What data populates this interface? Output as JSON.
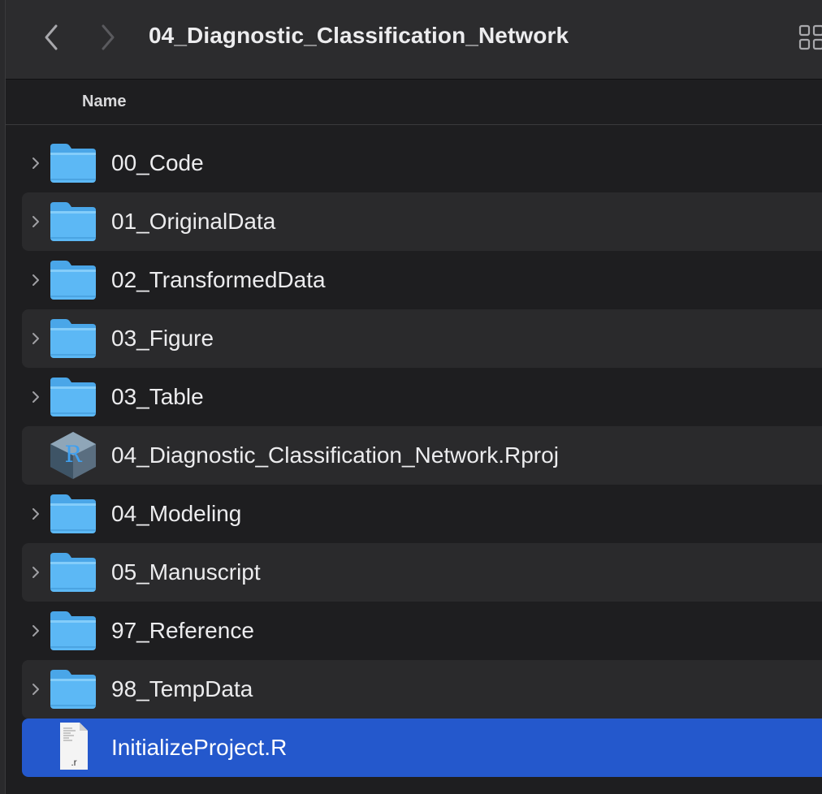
{
  "window": {
    "title": "04_Diagnostic_Classification_Network"
  },
  "toolbar": {
    "back_icon": "chevron-left-icon",
    "forward_icon": "chevron-right-icon",
    "view_icon": "grid-view-icon"
  },
  "columns": {
    "name": "Name"
  },
  "colors": {
    "folder_blue": "#5cb8f5",
    "selection": "#2458cc",
    "row_alt": "#2a2a2c",
    "background": "#1e1e20"
  },
  "items": [
    {
      "name": "00_Code",
      "kind": "folder",
      "expandable": true
    },
    {
      "name": "01_OriginalData",
      "kind": "folder",
      "expandable": true
    },
    {
      "name": "02_TransformedData",
      "kind": "folder",
      "expandable": true
    },
    {
      "name": "03_Figure",
      "kind": "folder",
      "expandable": true
    },
    {
      "name": "03_Table",
      "kind": "folder",
      "expandable": true
    },
    {
      "name": "04_Diagnostic_Classification_Network.Rproj",
      "kind": "rproj",
      "expandable": false
    },
    {
      "name": "04_Modeling",
      "kind": "folder",
      "expandable": true
    },
    {
      "name": "05_Manuscript",
      "kind": "folder",
      "expandable": true
    },
    {
      "name": "97_Reference",
      "kind": "folder",
      "expandable": true
    },
    {
      "name": "98_TempData",
      "kind": "folder",
      "expandable": true
    },
    {
      "name": "InitializeProject.R",
      "kind": "r-script",
      "expandable": false,
      "selected": true,
      "file_ext": ".r",
      "rproj_letter": "R"
    }
  ]
}
